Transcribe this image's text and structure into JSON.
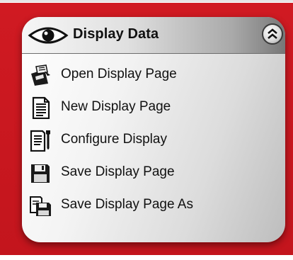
{
  "panel": {
    "title": "Display Data",
    "title_icon": "eye-icon",
    "collapse_icon": "double-chevron-up-icon"
  },
  "menu": {
    "items": [
      {
        "label": "Open Display Page",
        "icon": "open-page-icon"
      },
      {
        "label": "New Display Page",
        "icon": "new-page-icon"
      },
      {
        "label": "Configure Display",
        "icon": "configure-icon"
      },
      {
        "label": "Save Display Page",
        "icon": "floppy-disk-icon"
      },
      {
        "label": "Save Display Page As",
        "icon": "save-as-icon"
      }
    ]
  },
  "colors": {
    "frame": "#c3151d",
    "panel_light": "#ffffff",
    "panel_dark": "#bdbdbd",
    "text": "#111111"
  }
}
